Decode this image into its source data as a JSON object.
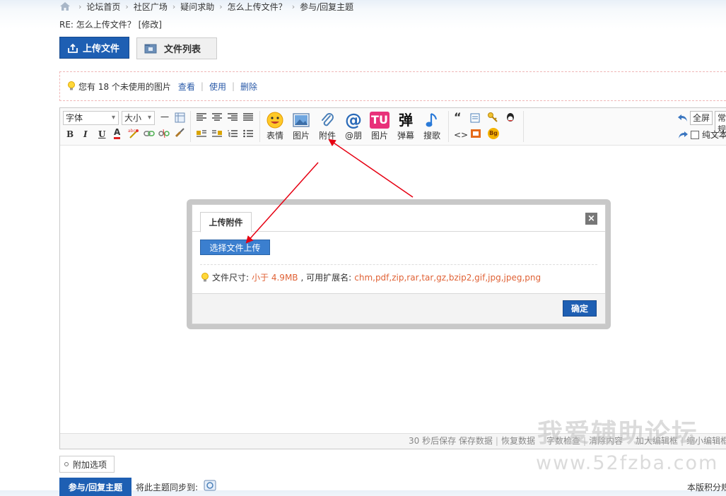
{
  "breadcrumb": [
    "论坛首页",
    "社区广场",
    "疑问求助",
    "怎么上传文件？",
    "参与/回复主题"
  ],
  "subject": {
    "prefix": "RE: 怎么上传文件？",
    "edit_link": "[修改]"
  },
  "buttons": {
    "upload_file": "上传文件",
    "file_list": "文件列表"
  },
  "notice": {
    "text": "您有 18 个未使用的图片",
    "view": "查看",
    "use": "使用",
    "delete": "删除"
  },
  "toolbar": {
    "font_select": "字体",
    "size_select": "大小",
    "hr": "一",
    "bold": "B",
    "italic": "I",
    "underline": "U",
    "font_color": "A",
    "emoji": "表情",
    "image": "图片",
    "attachment": "附件",
    "at_friend": "@朋",
    "image2": "图片",
    "danmaku": "弹幕",
    "music": "搜歌",
    "danmaku_glyph": "弹",
    "quote_glyph": "“",
    "code_glyph": "<>",
    "tu_glyph": "TU",
    "at_glyph": "@",
    "bg_glyph": "Bg",
    "abc_glyph": "abc",
    "fullscreen": "全屏",
    "normal": "常规",
    "plain_text": "纯文本"
  },
  "status_bar": {
    "autosave": "30 秒后保存 保存数据",
    "restore": "恢复数据",
    "word_check": "字数检查",
    "clear": "清除内容",
    "enlarge": "加大编辑框",
    "shrink": "缩小编辑框"
  },
  "dialog": {
    "tab": "上传附件",
    "close": "×",
    "choose_file": "选择文件上传",
    "size_label": "文件尺寸:",
    "size_value": "小于 4.9MB",
    "ext_label": ", 可用扩展名:",
    "ext_value": "chm,pdf,zip,rar,tar,gz,bzip2,gif,jpg,jpeg,png",
    "confirm": "确定"
  },
  "watermark": {
    "cn": "我爱辅助论坛",
    "url": "www.52fzba.com"
  },
  "bottom": {
    "extra_options": "附加选项",
    "reply": "参与/回复主题",
    "sync": "将此主题同步到:",
    "right": "本版积分规"
  },
  "colors": {
    "primary_blue": "#1e5fb3",
    "accent_red": "#e06236",
    "arrow_red": "#e60012"
  }
}
